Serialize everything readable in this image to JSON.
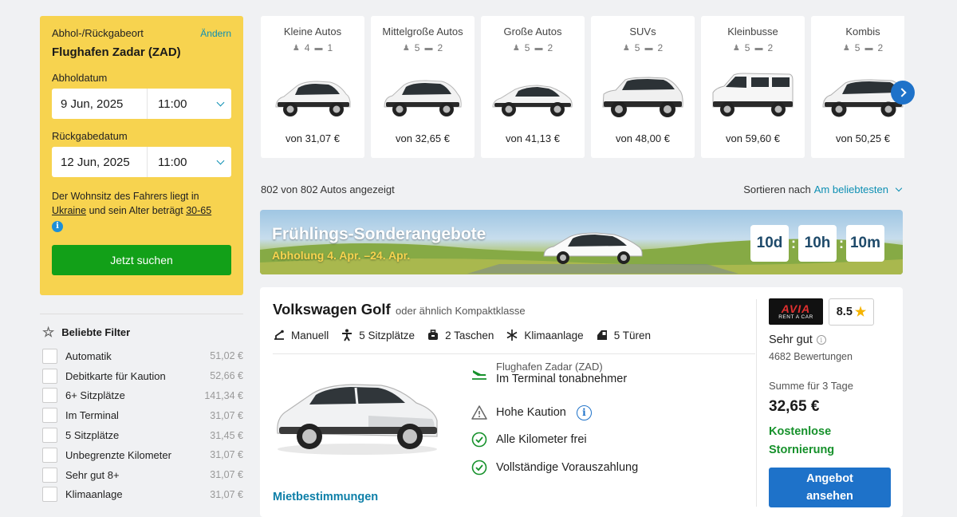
{
  "search": {
    "location_label": "Abhol-/Rückgabeort",
    "change_link": "Ändern",
    "location_value": "Flughafen Zadar (ZAD)",
    "pickup_label": "Abholdatum",
    "pickup_date": "9 Jun, 2025",
    "pickup_time": "11:00",
    "return_label": "Rückgabedatum",
    "return_date": "12 Jun, 2025",
    "return_time": "11:00",
    "residence_text_1": "Der Wohnsitz des Fahrers liegt in",
    "residence_country": "Ukraine",
    "residence_text_2": "und sein Alter beträgt",
    "residence_age": "30-65",
    "search_button": "Jetzt suchen"
  },
  "filters": {
    "title": "Beliebte Filter",
    "items": [
      {
        "label": "Automatik",
        "price": "51,02 €"
      },
      {
        "label": "Debitkarte für Kaution",
        "price": "52,66 €"
      },
      {
        "label": "6+ Sitzplätze",
        "price": "141,34 €"
      },
      {
        "label": "Im Terminal",
        "price": "31,07 €"
      },
      {
        "label": "5 Sitzplätze",
        "price": "31,45 €"
      },
      {
        "label": "Unbegrenzte Kilometer",
        "price": "31,07 €"
      },
      {
        "label": "Sehr gut 8+",
        "price": "31,07 €"
      },
      {
        "label": "Klimaanlage",
        "price": "31,07 €"
      }
    ]
  },
  "categories": [
    {
      "name": "Kleine Autos",
      "seats": "4",
      "bags": "1",
      "price": "von 31,07 €",
      "color": "#ffffff"
    },
    {
      "name": "Mittelgroße Autos",
      "seats": "5",
      "bags": "2",
      "price": "von 32,65 €",
      "color": "#ffffff"
    },
    {
      "name": "Große Autos",
      "seats": "5",
      "bags": "2",
      "price": "von 41,13 €",
      "color": "#ffffff"
    },
    {
      "name": "SUVs",
      "seats": "5",
      "bags": "2",
      "price": "von 48,00 €",
      "color": "#ffffff"
    },
    {
      "name": "Kleinbusse",
      "seats": "5",
      "bags": "2",
      "price": "von 59,60 €",
      "color": "#ffffff"
    },
    {
      "name": "Kombis",
      "seats": "5",
      "bags": "2",
      "price": "von 50,25 €",
      "color": "#ffffff"
    }
  ],
  "results": {
    "count_text": "802 von 802 Autos angezeigt",
    "sort_label": "Sortieren nach",
    "sort_value": "Am beliebtesten"
  },
  "banner": {
    "title": "Frühlings-Sonderangebote",
    "subtitle": "Abholung 4. Apr. –24. Apr.",
    "days": "10d",
    "hours": "10h",
    "minutes": "10m"
  },
  "offer": {
    "car_name": "Volkswagen Golf",
    "similar": "oder ähnlich Kompaktklasse",
    "features": {
      "transmission": "Manuell",
      "seats": "5 Sitzplätze",
      "bags": "2 Taschen",
      "ac": "Klimaanlage",
      "doors": "5 Türen"
    },
    "location_sub": "Flughafen Zadar (ZAD)",
    "location_main": "Im Terminal tonabnehmer",
    "deposit": "Hohe Kaution",
    "mileage": "Alle Kilometer frei",
    "prepay": "Vollständige Vorauszahlung",
    "terms_link": "Mietbestimmungen",
    "supplier_logo_word": "AVIA",
    "supplier_logo_sub": "RENT A CAR",
    "rating": "8.5",
    "rating_word": "Sehr gut",
    "reviews": "4682 Bewertungen",
    "total_label": "Summe für 3 Tage",
    "total_price": "32,65 €",
    "free_cancel": "Kostenlose Stornierung",
    "cta_line1": "Angebot",
    "cta_line2": "ansehen"
  },
  "colors": {
    "panel_yellow": "#f7d34f",
    "cta_green": "#12a018",
    "link_blue": "#0d8fb3",
    "cta_blue": "#1e72c9",
    "success_green": "#16912b"
  }
}
